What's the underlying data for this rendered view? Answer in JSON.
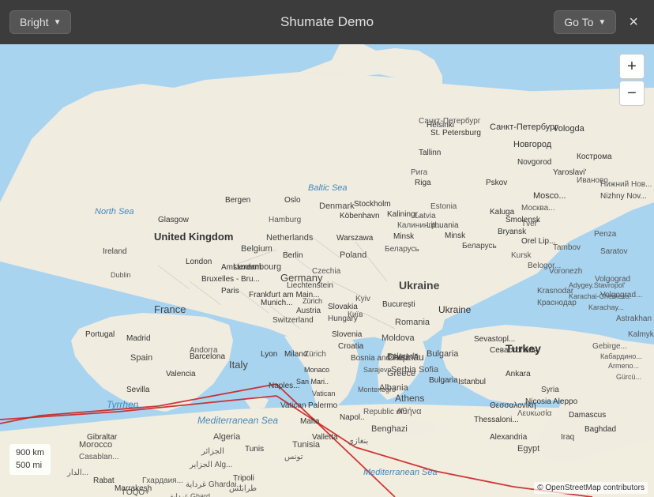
{
  "header": {
    "title": "Shumate Demo",
    "theme_button_label": "Bright",
    "goto_button_label": "Go To",
    "close_button_label": "×"
  },
  "zoom": {
    "plus_label": "+",
    "minus_label": "−"
  },
  "scale": {
    "km": "900 km",
    "mi": "500 mi"
  },
  "attribution": {
    "text": "© OpenStreetMap contributors"
  },
  "colors": {
    "sea": "#a8d4f0",
    "land": "#f0ece0",
    "land_dark": "#e8e4d8",
    "border": "#999",
    "city_text": "#222",
    "country_text": "#444",
    "water_text": "#5588bb",
    "route_line": "#cc2222"
  }
}
